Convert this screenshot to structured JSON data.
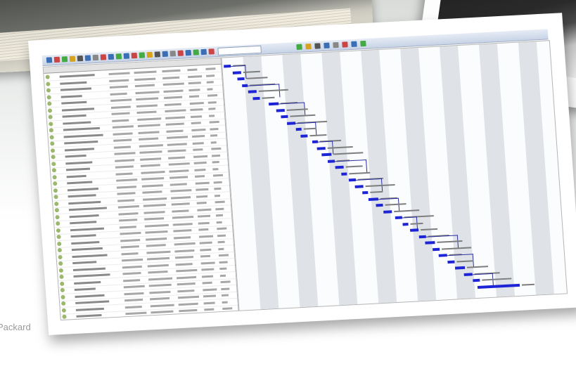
{
  "footer": {
    "text": "Packard"
  },
  "toolbar": {
    "field_value": ""
  },
  "colors": {
    "gantt_bar": "#1d24d6",
    "row_icon": "#9cb86e"
  },
  "icons": [
    "task-icon",
    "toolbar-button-icon"
  ]
}
